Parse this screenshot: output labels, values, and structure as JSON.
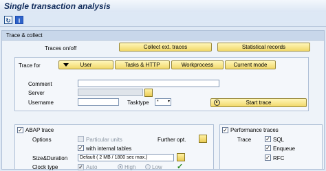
{
  "window": {
    "title": "Single transaction analysis"
  },
  "toolbar": {
    "icons": [
      "refresh-icon",
      "info-icon"
    ],
    "info_glyph": "i"
  },
  "trace_collect": {
    "title": "Trace & collect",
    "traces_label": "Traces on/off",
    "collect_button": "Collect ext. traces",
    "statistical_button": "Statistical records"
  },
  "trace_for": {
    "label": "Trace for",
    "tabs": [
      "User",
      "Tasks & HTTP",
      "Workprocess",
      "Current mode"
    ],
    "comment_label": "Comment",
    "comment_value": "",
    "server_label": "Server",
    "server_value": "",
    "username_label": "Username",
    "username_value": "",
    "tasktype_label": "Tasktype",
    "tasktype_value": "*",
    "start_button": "Start trace"
  },
  "abap_trace": {
    "title": "ABAP trace",
    "checked": true,
    "options_label": "Options",
    "particular_units": "Particular units",
    "particular_units_checked": false,
    "internal_tables": "with internal tables",
    "internal_tables_checked": true,
    "further_opt_label": "Further opt.",
    "size_label": "Size&Duration",
    "size_value": "Default ( 2 MB / 1800 sec max.)",
    "clock_label": "Clock type",
    "clock_options": [
      "Auto",
      "High",
      "Low"
    ],
    "clock_selected": "Auto"
  },
  "performance": {
    "title": "Performance traces",
    "checked": true,
    "trace_label": "Trace",
    "items": [
      {
        "label": "SQL",
        "checked": true
      },
      {
        "label": "Enqueue",
        "checked": true
      },
      {
        "label": "RFC",
        "checked": true
      }
    ]
  },
  "colors": {
    "accent": "#f1d86a",
    "panel_header": "#c8d7ea",
    "title": "#0f2a5a"
  }
}
